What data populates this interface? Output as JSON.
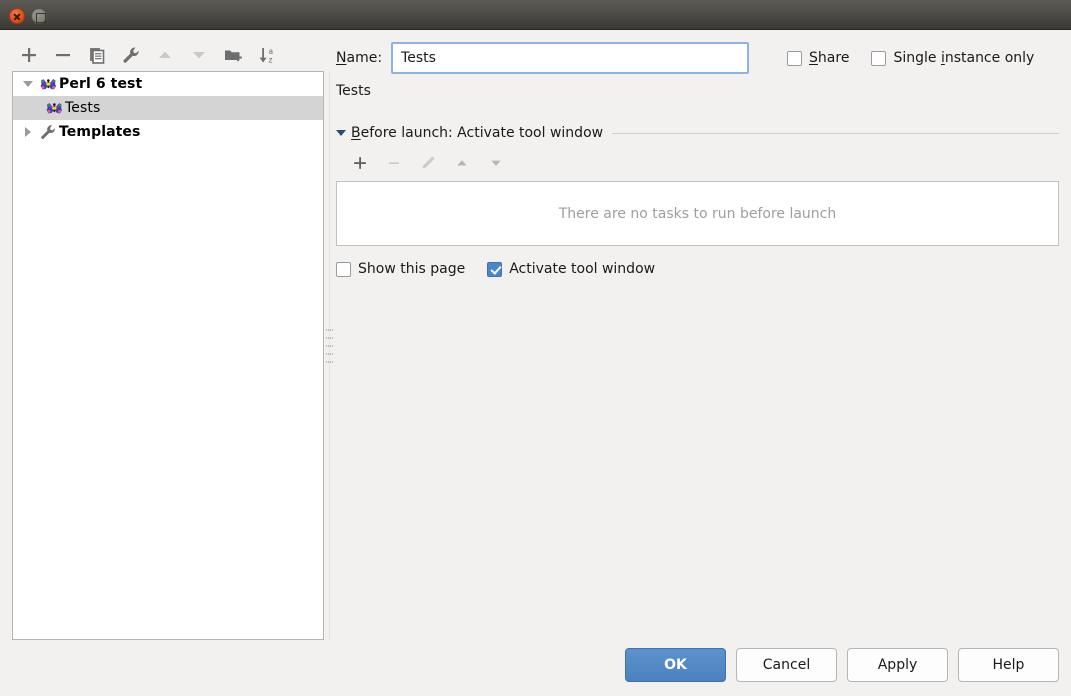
{
  "window": {
    "close_button": "close-window",
    "maximize_button": "maximize-window"
  },
  "left_toolbar": {
    "items": [
      {
        "icon": "plus-icon",
        "tooltip": "Add New Configuration",
        "enabled": true
      },
      {
        "icon": "minus-icon",
        "tooltip": "Remove Configuration",
        "enabled": true
      },
      {
        "icon": "copy-icon",
        "tooltip": "Copy Configuration",
        "enabled": true
      },
      {
        "icon": "wrench-icon",
        "tooltip": "Edit defaults",
        "enabled": true
      },
      {
        "icon": "arrow-up-icon",
        "tooltip": "Move Up",
        "enabled": false
      },
      {
        "icon": "arrow-down-icon",
        "tooltip": "Move Down",
        "enabled": false
      },
      {
        "icon": "new-folder-icon",
        "tooltip": "Create New Folder",
        "enabled": true
      },
      {
        "icon": "sort-az-icon",
        "tooltip": "Sort Configurations",
        "enabled": true
      }
    ]
  },
  "tree": {
    "nodes": [
      {
        "label": "Perl 6 test",
        "icon": "camelia-butterfly-icon",
        "twisty": "down",
        "level": 0,
        "bold": true,
        "selected": false
      },
      {
        "label": "Tests",
        "icon": "camelia-butterfly-icon",
        "twisty": "none",
        "level": 1,
        "bold": false,
        "selected": true
      },
      {
        "label": "Templates",
        "icon": "wrench-icon",
        "twisty": "right",
        "level": 0,
        "bold": true,
        "selected": false
      }
    ]
  },
  "form": {
    "name_label_pre": "N",
    "name_label_post": "ame:",
    "name_value": "Tests",
    "name_placeholder": "",
    "share": {
      "label_pre": "S",
      "label_post": "hare",
      "checked": false
    },
    "single_instance": {
      "label_pre": "Single ",
      "label_mn": "i",
      "label_post": "nstance only",
      "checked": false
    },
    "subtitle": "Tests"
  },
  "before_launch": {
    "title_pre": "B",
    "title_post": "efore launch: Activate tool window",
    "toolbar": [
      {
        "icon": "plus-icon",
        "tooltip": "Add",
        "enabled": true
      },
      {
        "icon": "minus-icon",
        "tooltip": "Remove",
        "enabled": false
      },
      {
        "icon": "pencil-icon",
        "tooltip": "Edit",
        "enabled": false
      },
      {
        "icon": "arrow-up-icon",
        "tooltip": "Move Up",
        "enabled": true
      },
      {
        "icon": "arrow-down-icon",
        "tooltip": "Move Down",
        "enabled": true
      }
    ],
    "empty_text": "There are no tasks to run before launch",
    "show_this_page": {
      "label": "Show this page",
      "checked": false
    },
    "activate_tool_window": {
      "label": "Activate tool window",
      "checked": true
    }
  },
  "buttons": {
    "ok": "OK",
    "cancel": "Cancel",
    "apply": "Apply",
    "help": "Help"
  },
  "colors": {
    "accent": "#4a86c8",
    "primary_button": "#4b82bf",
    "titlebar": "#4e4c46",
    "close_button": "#dd4814",
    "selection": "#d4d4d4",
    "panel_bg": "#f2f1f0",
    "field_focus_border": "#8cb4de",
    "muted_text": "#9e9e9e"
  }
}
